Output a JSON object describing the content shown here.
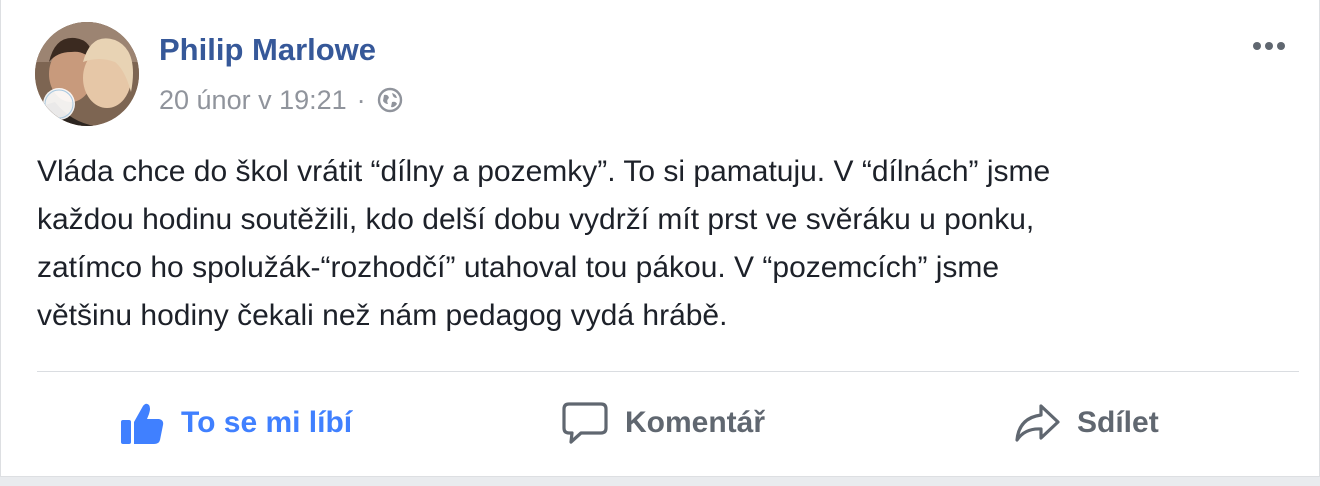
{
  "post": {
    "author": "Philip Marlowe",
    "timestamp": "20 únor v 19:21",
    "separator": "·",
    "privacy_icon": "globe-icon",
    "more_icon": "more-options-icon",
    "text_lines": [
      "Vláda chce do škol vrátit “dílny a pozemky”. To si pamatuju. V “dílnách” jsme",
      "každou hodinu soutěžili, kdo delší dobu vydrží mít prst ve svěráku u ponku,",
      "zatímco ho spolužák-“rozhodčí” utahoval tou pákou. V “pozemcích” jsme",
      "většinu hodiny čekali než nám pedagog vydá hrábě."
    ]
  },
  "actions": {
    "like_label": "To se mi líbí",
    "comment_label": "Komentář",
    "share_label": "Sdílet"
  },
  "colors": {
    "author": "#365899",
    "like_active": "#4080ff",
    "action_text": "#606770",
    "body_text": "#1d2129",
    "meta_text": "#90949c"
  }
}
